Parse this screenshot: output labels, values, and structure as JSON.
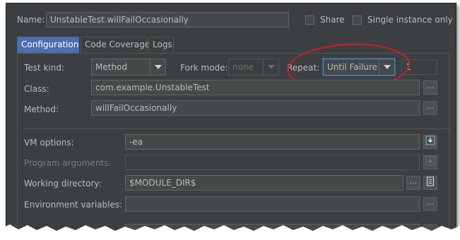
{
  "header": {
    "name_label": "Name:",
    "name_value": "UnstableTest.willFailOccasionally",
    "share_label": "Share",
    "single_instance_label": "Single instance only"
  },
  "tabs": [
    {
      "label": "Configuration",
      "active": true
    },
    {
      "label": "Code Coverage",
      "active": false
    },
    {
      "label": "Logs",
      "active": false
    }
  ],
  "config": {
    "test_kind_label": "Test kind:",
    "test_kind_value": "Method",
    "fork_mode_label": "Fork mode:",
    "fork_mode_value": "none",
    "repeat_label": "Repeat:",
    "repeat_value": "Until Failure",
    "repeat_count": "1",
    "class_label": "Class:",
    "class_value": "com.example.UnstableTest",
    "method_label": "Method:",
    "method_value": "willFailOccasionally",
    "vm_options_label": "VM options:",
    "vm_options_value": "-ea",
    "program_args_label": "Program arguments:",
    "program_args_value": "",
    "working_dir_label": "Working directory:",
    "working_dir_value": "$MODULE_DIR$",
    "env_vars_label": "Environment variables:",
    "env_vars_value": ""
  },
  "buttons": {
    "browse_label": "..."
  },
  "colors": {
    "panel_bg": "#3c3f41",
    "active_tab": "#4b6eaf",
    "highlight_ellipse": "#d21f1f",
    "focus_border": "#4a88c7"
  },
  "icons": {
    "dropdown": "chevron-down-icon",
    "expand": "expand-field-icon",
    "macros": "document-icon"
  }
}
